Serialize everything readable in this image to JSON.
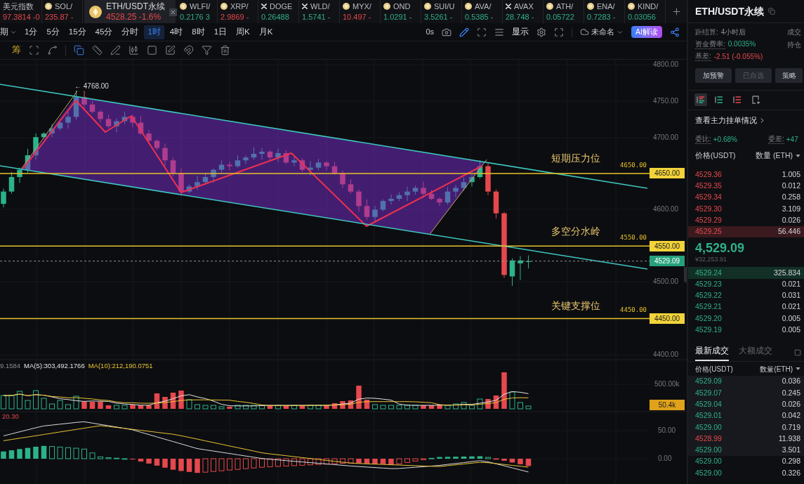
{
  "ticker_tabs": [
    {
      "symbol": "美元指数",
      "price": "97.3814 -0",
      "falling": true,
      "kind": "text",
      "selected": false
    },
    {
      "symbol": "SOL/",
      "price": "235.87 -",
      "falling": true,
      "kind": "coin",
      "selected": false
    },
    {
      "symbol": "ETH/USDT永续",
      "price": "4528.25 -1.6%",
      "falling": true,
      "kind": "coin",
      "selected": true
    },
    {
      "symbol": "WLFI/",
      "price": "0.2176 3",
      "falling": false,
      "kind": "coin",
      "selected": false
    },
    {
      "symbol": "XRP/",
      "price": "2.9869 -",
      "falling": true,
      "kind": "coin",
      "selected": false
    },
    {
      "symbol": "DOGE",
      "price": "0.26488",
      "falling": false,
      "kind": "cross",
      "selected": false
    },
    {
      "symbol": "WLD/",
      "price": "1.5741 -",
      "falling": false,
      "kind": "cross",
      "selected": false
    },
    {
      "symbol": "MYX/",
      "price": "10.497 -",
      "falling": true,
      "kind": "coin",
      "selected": false
    },
    {
      "symbol": "OND",
      "price": "1.0291 -",
      "falling": false,
      "kind": "coin",
      "selected": false
    },
    {
      "symbol": "SUI/U",
      "price": "3.5261 -",
      "falling": false,
      "kind": "coin",
      "selected": false
    },
    {
      "symbol": "AVA/",
      "price": "0.5385 -",
      "falling": false,
      "kind": "coin",
      "selected": false
    },
    {
      "symbol": "AVAX",
      "price": "28.748 -",
      "falling": false,
      "kind": "cross",
      "selected": false
    },
    {
      "symbol": "ATH/",
      "price": "0.05722",
      "falling": false,
      "kind": "coin",
      "selected": false
    },
    {
      "symbol": "ENA/",
      "price": "0.7283 -",
      "falling": false,
      "kind": "coin",
      "selected": false
    },
    {
      "symbol": "KIND/",
      "price": "0.03056",
      "falling": false,
      "kind": "coin",
      "selected": false
    }
  ],
  "intervals": {
    "menu_label": "期",
    "items": [
      {
        "label": "1分",
        "selected": false
      },
      {
        "label": "5分",
        "selected": false
      },
      {
        "label": "15分",
        "selected": false
      },
      {
        "label": "45分",
        "selected": false
      },
      {
        "label": "分时",
        "selected": false
      },
      {
        "label": "1时",
        "selected": true
      },
      {
        "label": "4时",
        "selected": false
      },
      {
        "label": "8时",
        "selected": false
      },
      {
        "label": "1日",
        "selected": false
      },
      {
        "label": "周K",
        "selected": false
      },
      {
        "label": "月K",
        "selected": false
      }
    ]
  },
  "chart_toolbar": {
    "countdown": "0s",
    "pen_active": true,
    "display_menu": "显示",
    "layout_name": "未命名",
    "ai_button": "AI解读"
  },
  "drawing_toolbar": {
    "chips_button": "筹",
    "tool_groups": [
      [
        {
          "kind": "scan",
          "selected": false
        },
        {
          "kind": "spline",
          "selected": false
        }
      ],
      [
        {
          "kind": "copy",
          "selected": true
        },
        {
          "kind": "ruler",
          "selected": false
        },
        {
          "kind": "pen-line",
          "selected": false
        },
        {
          "kind": "candles",
          "selected": false
        },
        {
          "kind": "square",
          "selected": false
        },
        {
          "kind": "edit",
          "selected": false
        },
        {
          "kind": "magnet",
          "selected": false
        },
        {
          "kind": "filter",
          "selected": false
        },
        {
          "kind": "trash",
          "selected": false
        }
      ]
    ]
  },
  "price_chart": {
    "axis_labels": [
      "4800.00",
      "4750.00",
      "4700.00",
      "4600.00",
      "4500.00",
      "4400.00"
    ],
    "high_marker": "← 4768.00",
    "levels": [
      {
        "note": "短期压力位",
        "line_label": "4650.00",
        "axis_tag": "4650.00"
      },
      {
        "note": "多空分水岭",
        "line_label": "4550.00",
        "axis_tag": "4550.00"
      },
      {
        "note": "关键支撑位",
        "line_label": "4450.00",
        "axis_tag": "4450.00"
      }
    ],
    "last_price_tag": "4529.09"
  },
  "volume_pane": {
    "legend": [
      {
        "text": "9.1584",
        "kind": "value"
      },
      {
        "text": "MA(5):303,492.1766",
        "kind": "ma5"
      },
      {
        "text": "MA(10):212,190.0751",
        "kind": "ma10"
      }
    ],
    "axis_label": "500.00k",
    "last_volume_tag": "50.4k"
  },
  "macd_pane": {
    "legend": "20.30",
    "axis_labels": [
      "50.00",
      "0.00"
    ]
  },
  "market_panel": {
    "title": "ETH/USDT永续",
    "stats": [
      {
        "label": "距结算:",
        "value": "4小时后",
        "hint": false,
        "side_label": "成交"
      },
      {
        "label": "资金费率:",
        "value": "0.0035%",
        "rising": true,
        "hint": true,
        "side_label": "持仓"
      },
      {
        "label": "基差:",
        "value": "-2.51 (-0.055%)",
        "rising": false,
        "hint": true
      }
    ],
    "buttons": [
      {
        "label": "加预警",
        "disabled": false
      },
      {
        "label": "已自选",
        "disabled": true
      },
      {
        "label": "策略",
        "disabled": false
      }
    ],
    "view_modes": [
      {
        "kind": "both",
        "selected": true
      },
      {
        "kind": "bids",
        "selected": false
      },
      {
        "kind": "asks",
        "selected": false
      },
      {
        "kind": "custom",
        "selected": false
      }
    ],
    "main_orders_link": "查看主力挂单情况",
    "ratios": [
      {
        "label": "委比:",
        "value": "+0.68%"
      },
      {
        "label": "委差:",
        "value": "+47"
      }
    ],
    "book_header": {
      "price": "价格(USDT)",
      "amount": "数量 (ETH)"
    },
    "asks": [
      {
        "price": "4529.36",
        "amount": "1.005",
        "highlighted": false
      },
      {
        "price": "4529.35",
        "amount": "0.012",
        "highlighted": false
      },
      {
        "price": "4529.34",
        "amount": "0.258",
        "highlighted": false
      },
      {
        "price": "4529.30",
        "amount": "3.109",
        "highlighted": false
      },
      {
        "price": "4529.29",
        "amount": "0.026",
        "highlighted": false
      },
      {
        "price": "4529.25",
        "amount": "56.446",
        "highlighted": true
      }
    ],
    "last_price": "4,529.09",
    "last_price_cny": "¥32,253.91",
    "bids": [
      {
        "price": "4529.24",
        "amount": "325.834",
        "highlighted": true
      },
      {
        "price": "4529.23",
        "amount": "0.021",
        "highlighted": false
      },
      {
        "price": "4529.22",
        "amount": "0.031",
        "highlighted": false
      },
      {
        "price": "4529.21",
        "amount": "0.021",
        "highlighted": false
      },
      {
        "price": "4529.20",
        "amount": "0.005",
        "highlighted": false
      },
      {
        "price": "4529.19",
        "amount": "0.005",
        "highlighted": false
      }
    ],
    "trade_tabs": [
      {
        "label": "最新成交",
        "selected": true
      },
      {
        "label": "大额成交",
        "selected": false
      }
    ],
    "trade_header": {
      "price": "价格(USDT)",
      "amount": "数量(ETH)"
    },
    "trades": [
      {
        "price": "4529.09",
        "amount": "0.036",
        "falling": false,
        "highlighted": true
      },
      {
        "price": "4529.07",
        "amount": "0.245",
        "falling": false,
        "highlighted": true
      },
      {
        "price": "4529.04",
        "amount": "0.026",
        "falling": false,
        "highlighted": true
      },
      {
        "price": "4529.01",
        "amount": "0.042",
        "falling": false,
        "highlighted": true
      },
      {
        "price": "4529.00",
        "amount": "0.719",
        "falling": false,
        "highlighted": true
      },
      {
        "price": "4528.99",
        "amount": "11.938",
        "falling": true,
        "highlighted": true
      },
      {
        "price": "4529.00",
        "amount": "3.501",
        "falling": false,
        "highlighted": true
      },
      {
        "price": "4529.00",
        "amount": "0.298",
        "falling": false,
        "highlighted": false
      },
      {
        "price": "4529.00",
        "amount": "0.326",
        "falling": false,
        "highlighted": false
      }
    ]
  }
}
